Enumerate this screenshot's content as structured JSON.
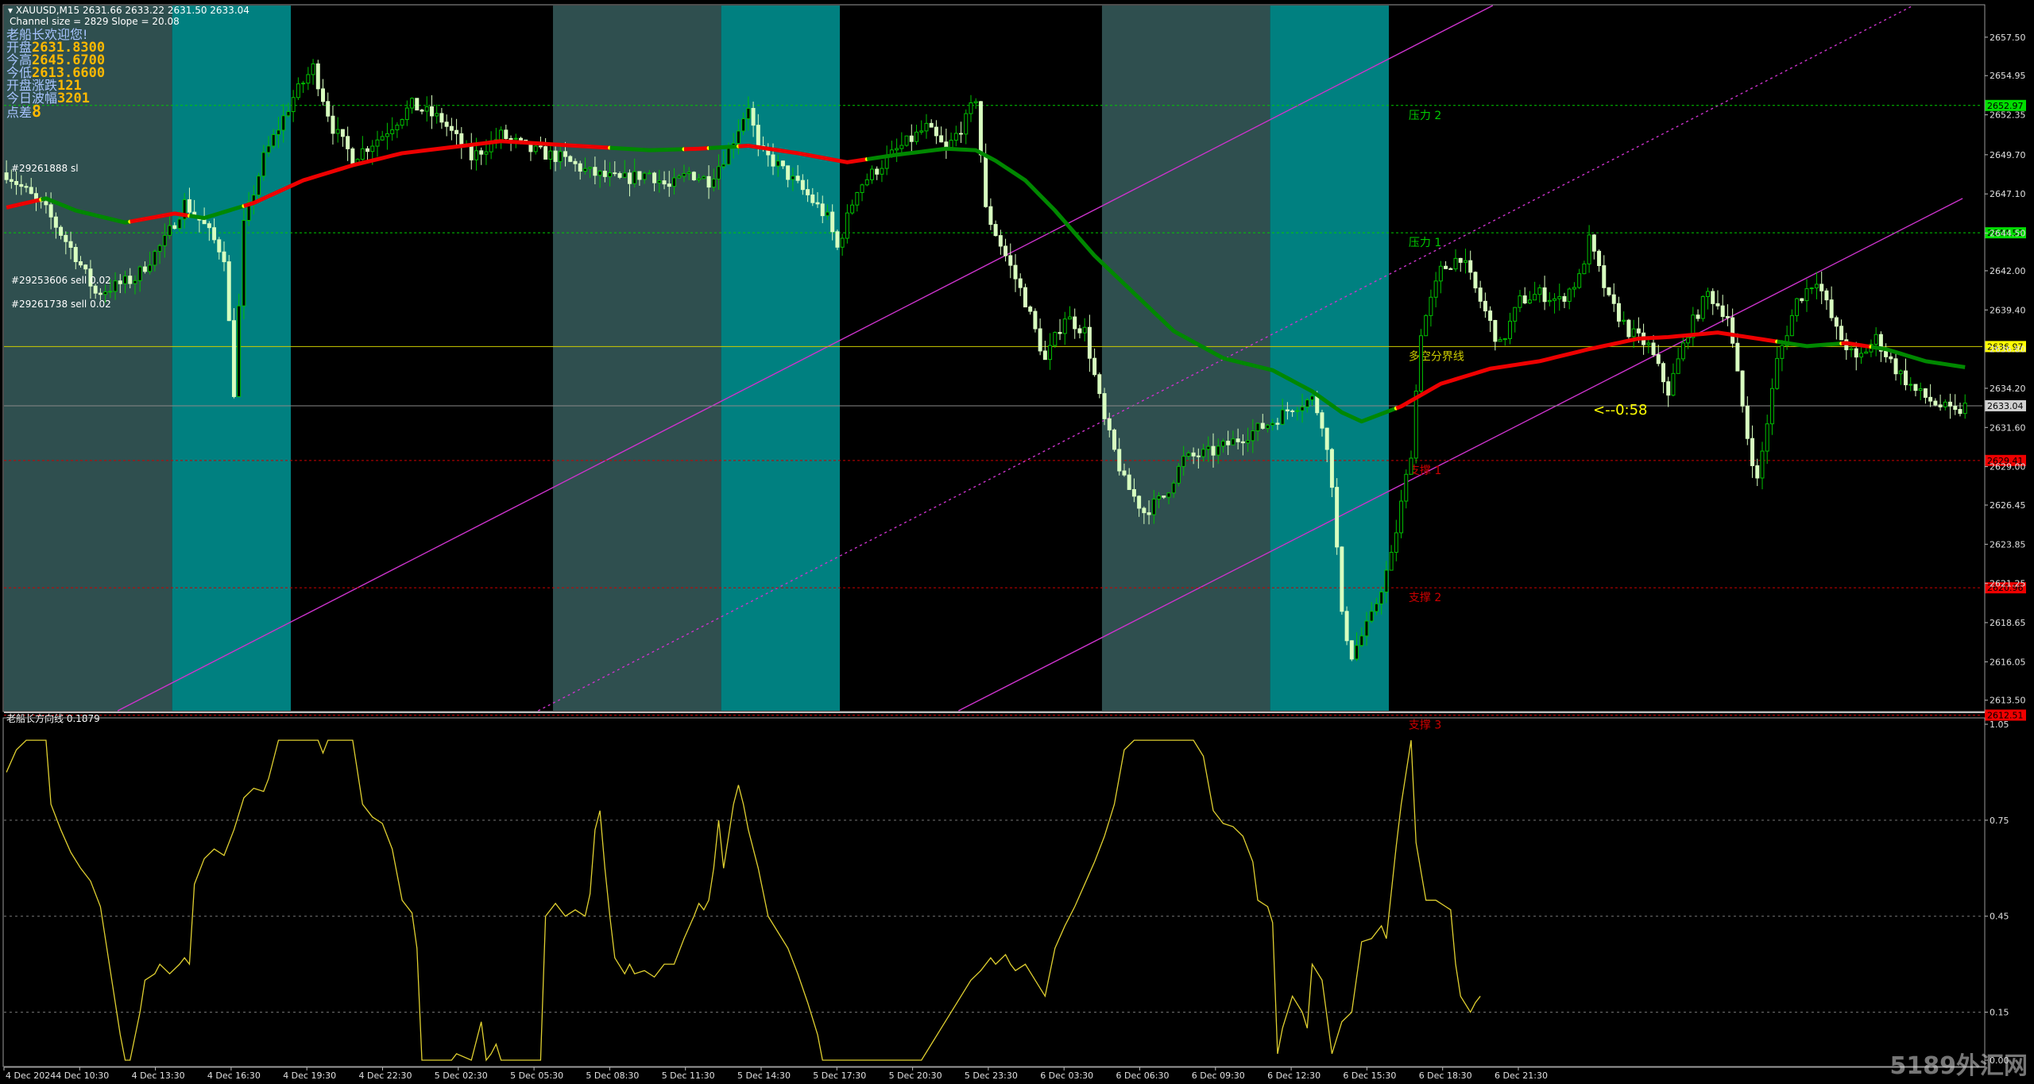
{
  "header": {
    "symbol_line": "XAUUSD,M15  2631.66 2633.22 2631.50 2633.04",
    "channel_line": "Channel size = 2829 Slope = 20.08"
  },
  "info_panel": {
    "welcome": "老船长欢迎您!",
    "rows": [
      {
        "label": "开盘",
        "value": "2631.8300"
      },
      {
        "label": "今高",
        "value": "2645.6700"
      },
      {
        "label": "今低",
        "value": "2613.6600"
      },
      {
        "label": "开盘涨跌",
        "value": "121"
      },
      {
        "label": "今日波幅",
        "value": "3201"
      },
      {
        "label": "点差",
        "value": "8"
      }
    ]
  },
  "order_labels": [
    "#29261888 sl",
    "#29253606 sell 0.02",
    "#29261738 sell 0.02"
  ],
  "countdown": "<--0:58",
  "colors": {
    "background": "#000000",
    "zone_gray": "#2f4f4f",
    "zone_teal": "#008080",
    "candle": "#d8ffc0",
    "candle_bull": "#00c000",
    "ma_up": "#ee0000",
    "ma_down": "#008800",
    "channel": "#cc33cc",
    "resistance": "#00cc00",
    "support": "#cc0000",
    "pivot": "#cccc00",
    "oscillator": "#e0d030"
  },
  "chart_data": [
    {
      "type": "candlestick",
      "title": "",
      "ylim": [
        2612.8,
        2659.6
      ],
      "y_ticks": [
        "2657.50",
        "2654.95",
        "2652.35",
        "2649.70",
        "2647.10",
        "2644.50",
        "2642.00",
        "2639.40",
        "2636.80",
        "2634.20",
        "2631.60",
        "2629.00",
        "2626.45",
        "2623.85",
        "2621.25",
        "2618.65",
        "2616.05",
        "2613.50"
      ],
      "x_labels": [
        "4 Dec 2024",
        "4 Dec 10:30",
        "4 Dec 13:30",
        "4 Dec 16:30",
        "4 Dec 19:30",
        "4 Dec 22:30",
        "5 Dec 02:30",
        "5 Dec 05:30",
        "5 Dec 08:30",
        "5 Dec 11:30",
        "5 Dec 14:30",
        "5 Dec 17:30",
        "5 Dec 20:30",
        "5 Dec 23:30",
        "6 Dec 03:30",
        "6 Dec 06:30",
        "6 Dec 09:30",
        "6 Dec 12:30",
        "6 Dec 15:30",
        "6 Dec 18:30",
        "6 Dec 21:30"
      ],
      "price_path": [
        [
          0,
          2648.5
        ],
        [
          8,
          2646
        ],
        [
          14,
          2643
        ],
        [
          18,
          2640.5
        ],
        [
          26,
          2641.5
        ],
        [
          32,
          2644
        ],
        [
          36,
          2646.5
        ],
        [
          40,
          2645
        ],
        [
          44,
          2643
        ],
        [
          46,
          2634
        ],
        [
          48,
          2645
        ],
        [
          52,
          2649.5
        ],
        [
          58,
          2653.5
        ],
        [
          62,
          2655.5
        ],
        [
          66,
          2651.5
        ],
        [
          70,
          2649.5
        ],
        [
          76,
          2651
        ],
        [
          82,
          2653
        ],
        [
          88,
          2652
        ],
        [
          94,
          2649.5
        ],
        [
          100,
          2651
        ],
        [
          106,
          2650
        ],
        [
          112,
          2649.5
        ],
        [
          118,
          2648.5
        ],
        [
          124,
          2648
        ],
        [
          130,
          2648.5
        ],
        [
          134,
          2647.5
        ],
        [
          138,
          2648.5
        ],
        [
          142,
          2648
        ],
        [
          146,
          2650
        ],
        [
          150,
          2653
        ],
        [
          152,
          2650
        ],
        [
          156,
          2649
        ],
        [
          162,
          2647
        ],
        [
          166,
          2645.5
        ],
        [
          168,
          2643.5
        ],
        [
          172,
          2647.5
        ],
        [
          180,
          2650
        ],
        [
          186,
          2651.5
        ],
        [
          190,
          2650
        ],
        [
          194,
          2652
        ],
        [
          196,
          2653.5
        ],
        [
          198,
          2646
        ],
        [
          202,
          2643
        ],
        [
          206,
          2640
        ],
        [
          210,
          2636
        ],
        [
          214,
          2639
        ],
        [
          218,
          2638
        ],
        [
          222,
          2632
        ],
        [
          226,
          2628
        ],
        [
          230,
          2626
        ],
        [
          234,
          2627
        ],
        [
          238,
          2629.5
        ],
        [
          244,
          2630
        ],
        [
          250,
          2631
        ],
        [
          256,
          2632
        ],
        [
          260,
          2633
        ],
        [
          264,
          2633.5
        ],
        [
          266,
          2632
        ],
        [
          268,
          2628
        ],
        [
          270,
          2619
        ],
        [
          272,
          2616.5
        ],
        [
          276,
          2619
        ],
        [
          280,
          2623
        ],
        [
          284,
          2630
        ],
        [
          286,
          2638
        ],
        [
          290,
          2642
        ],
        [
          294,
          2643
        ],
        [
          298,
          2640
        ],
        [
          302,
          2637
        ],
        [
          306,
          2640
        ],
        [
          310,
          2640.5
        ],
        [
          314,
          2640
        ],
        [
          318,
          2641.5
        ],
        [
          320,
          2644
        ],
        [
          324,
          2640
        ],
        [
          328,
          2638
        ],
        [
          332,
          2637
        ],
        [
          336,
          2634
        ],
        [
          340,
          2638
        ],
        [
          344,
          2640.5
        ],
        [
          348,
          2639
        ],
        [
          352,
          2631
        ],
        [
          354,
          2628
        ],
        [
          358,
          2636
        ],
        [
          362,
          2640
        ],
        [
          366,
          2641.5
        ],
        [
          370,
          2638
        ],
        [
          374,
          2636
        ],
        [
          378,
          2637.5
        ],
        [
          382,
          2635.5
        ],
        [
          386,
          2634
        ],
        [
          390,
          2633.2
        ],
        [
          394,
          2632.5
        ],
        [
          396,
          2633
        ]
      ],
      "moving_average_path": [
        [
          0,
          2646.2
        ],
        [
          8,
          2646.8
        ],
        [
          14,
          2646
        ],
        [
          24,
          2645.2
        ],
        [
          34,
          2645.8
        ],
        [
          40,
          2645.5
        ],
        [
          50,
          2646.5
        ],
        [
          60,
          2648
        ],
        [
          70,
          2649
        ],
        [
          80,
          2649.8
        ],
        [
          90,
          2650.2
        ],
        [
          100,
          2650.6
        ],
        [
          110,
          2650.4
        ],
        [
          120,
          2650.2
        ],
        [
          130,
          2650
        ],
        [
          140,
          2650.1
        ],
        [
          150,
          2650.3
        ],
        [
          160,
          2649.8
        ],
        [
          170,
          2649.2
        ],
        [
          180,
          2649.7
        ],
        [
          190,
          2650.1
        ],
        [
          196,
          2650
        ],
        [
          200,
          2649.3
        ],
        [
          206,
          2648
        ],
        [
          212,
          2646
        ],
        [
          220,
          2643
        ],
        [
          228,
          2640.5
        ],
        [
          236,
          2638
        ],
        [
          246,
          2636.2
        ],
        [
          256,
          2635.4
        ],
        [
          264,
          2634
        ],
        [
          270,
          2632.6
        ],
        [
          274,
          2632
        ],
        [
          282,
          2633
        ],
        [
          290,
          2634.5
        ],
        [
          300,
          2635.5
        ],
        [
          310,
          2636
        ],
        [
          320,
          2636.8
        ],
        [
          330,
          2637.5
        ],
        [
          336,
          2637.6
        ],
        [
          346,
          2637.9
        ],
        [
          354,
          2637.5
        ],
        [
          364,
          2637
        ],
        [
          372,
          2637.2
        ],
        [
          380,
          2636.8
        ],
        [
          388,
          2636
        ],
        [
          396,
          2635.6
        ]
      ],
      "ma_up_segments": [
        [
          0,
          7
        ],
        [
          25,
          37
        ],
        [
          48,
          122
        ],
        [
          137,
          142
        ],
        [
          148,
          174
        ],
        [
          281,
          358
        ],
        [
          371,
          377
        ]
      ],
      "levels": [
        {
          "label": "压力 2",
          "price": "2652.97",
          "kind": "resistance"
        },
        {
          "label": "压力 1",
          "price": "2644.52",
          "kind": "resistance"
        },
        {
          "label": "多空分界线",
          "price": "2636.97",
          "kind": "pivot"
        },
        {
          "label": "",
          "price": "2633.04",
          "kind": "current"
        },
        {
          "label": "支撑 1",
          "price": "2629.41",
          "kind": "support"
        },
        {
          "label": "支撑 2",
          "price": "2620.96",
          "kind": "support"
        },
        {
          "label": "支撑 3",
          "price": "2612.51",
          "kind": "support"
        }
      ],
      "zones": [
        {
          "from": 0,
          "to": 34,
          "kind": "gray"
        },
        {
          "from": 34,
          "to": 58,
          "kind": "teal"
        },
        {
          "from": 111,
          "to": 145,
          "kind": "gray"
        },
        {
          "from": 145,
          "to": 169,
          "kind": "teal"
        },
        {
          "from": 222,
          "to": 256,
          "kind": "gray"
        },
        {
          "from": 256,
          "to": 280,
          "kind": "teal"
        }
      ],
      "channel_lines": [
        {
          "kind": "solid",
          "points": [
            [
              23,
              2612.8
            ],
            [
              301,
              2659.6
            ]
          ]
        },
        {
          "kind": "dotted",
          "points": [
            [
              108,
              2612.8
            ],
            [
              386,
              2659.6
            ]
          ]
        },
        {
          "kind": "solid",
          "points": [
            [
              193,
              2612.8
            ],
            [
              396,
              2646.8
            ]
          ]
        }
      ]
    },
    {
      "type": "line",
      "title": "老船长方向线 0.1879",
      "ylim": [
        0,
        1.05
      ],
      "y_ticks": [
        "1.05",
        "0.75",
        "0.45",
        "0.15",
        "0.00"
      ],
      "values": [
        [
          0,
          0.9
        ],
        [
          2,
          0.97
        ],
        [
          4,
          1.0
        ],
        [
          8,
          1.0
        ],
        [
          9,
          0.8
        ],
        [
          11,
          0.72
        ],
        [
          13,
          0.65
        ],
        [
          15,
          0.6
        ],
        [
          17,
          0.56
        ],
        [
          19,
          0.48
        ],
        [
          21,
          0.28
        ],
        [
          23,
          0.08
        ],
        [
          24,
          0
        ],
        [
          25,
          0
        ],
        [
          27,
          0.15
        ],
        [
          28,
          0.25
        ],
        [
          30,
          0.27
        ],
        [
          31,
          0.3
        ],
        [
          33,
          0.27
        ],
        [
          35,
          0.3
        ],
        [
          36,
          0.32
        ],
        [
          37,
          0.3
        ],
        [
          38,
          0.55
        ],
        [
          40,
          0.63
        ],
        [
          42,
          0.66
        ],
        [
          44,
          0.64
        ],
        [
          46,
          0.72
        ],
        [
          48,
          0.82
        ],
        [
          50,
          0.85
        ],
        [
          52,
          0.84
        ],
        [
          53,
          0.88
        ],
        [
          55,
          1.0
        ],
        [
          63,
          1.0
        ],
        [
          64,
          0.96
        ],
        [
          65,
          1.0
        ],
        [
          70,
          1.0
        ],
        [
          72,
          0.8
        ],
        [
          74,
          0.76
        ],
        [
          76,
          0.74
        ],
        [
          78,
          0.66
        ],
        [
          80,
          0.5
        ],
        [
          82,
          0.46
        ],
        [
          83,
          0.35
        ],
        [
          84,
          0
        ],
        [
          90,
          0
        ],
        [
          91,
          0.02
        ],
        [
          94,
          0
        ],
        [
          96,
          0.12
        ],
        [
          97,
          0
        ],
        [
          98,
          0.02
        ],
        [
          99,
          0.05
        ],
        [
          100,
          0
        ],
        [
          108,
          0
        ],
        [
          109,
          0.45
        ],
        [
          111,
          0.49
        ],
        [
          113,
          0.45
        ],
        [
          115,
          0.47
        ],
        [
          117,
          0.45
        ],
        [
          118,
          0.52
        ],
        [
          119,
          0.72
        ],
        [
          120,
          0.78
        ],
        [
          121,
          0.6
        ],
        [
          122,
          0.45
        ],
        [
          123,
          0.32
        ],
        [
          125,
          0.27
        ],
        [
          126,
          0.3
        ],
        [
          127,
          0.27
        ],
        [
          129,
          0.28
        ],
        [
          131,
          0.26
        ],
        [
          133,
          0.3
        ],
        [
          135,
          0.3
        ],
        [
          137,
          0.38
        ],
        [
          139,
          0.45
        ],
        [
          140,
          0.49
        ],
        [
          141,
          0.47
        ],
        [
          142,
          0.5
        ],
        [
          143,
          0.6
        ],
        [
          144,
          0.75
        ],
        [
          145,
          0.6
        ],
        [
          147,
          0.8
        ],
        [
          148,
          0.86
        ],
        [
          149,
          0.8
        ],
        [
          150,
          0.72
        ],
        [
          152,
          0.6
        ],
        [
          154,
          0.45
        ],
        [
          156,
          0.4
        ],
        [
          158,
          0.35
        ],
        [
          160,
          0.27
        ],
        [
          162,
          0.18
        ],
        [
          164,
          0.08
        ],
        [
          165,
          0
        ],
        [
          185,
          0
        ],
        [
          187,
          0.05
        ],
        [
          189,
          0.1
        ],
        [
          191,
          0.15
        ],
        [
          193,
          0.2
        ],
        [
          195,
          0.25
        ],
        [
          197,
          0.28
        ],
        [
          199,
          0.32
        ],
        [
          200,
          0.3
        ],
        [
          202,
          0.33
        ],
        [
          203,
          0.3
        ],
        [
          204,
          0.28
        ],
        [
          206,
          0.3
        ],
        [
          208,
          0.25
        ],
        [
          210,
          0.2
        ],
        [
          212,
          0.35
        ],
        [
          214,
          0.42
        ],
        [
          216,
          0.48
        ],
        [
          218,
          0.55
        ],
        [
          220,
          0.62
        ],
        [
          222,
          0.7
        ],
        [
          224,
          0.8
        ],
        [
          226,
          0.97
        ],
        [
          228,
          1.0
        ],
        [
          240,
          1.0
        ],
        [
          242,
          0.95
        ],
        [
          244,
          0.78
        ],
        [
          246,
          0.74
        ],
        [
          248,
          0.73
        ],
        [
          250,
          0.7
        ],
        [
          252,
          0.62
        ],
        [
          253,
          0.5
        ],
        [
          255,
          0.48
        ],
        [
          256,
          0.43
        ],
        [
          257,
          0.02
        ],
        [
          258,
          0.1
        ],
        [
          260,
          0.2
        ],
        [
          262,
          0.15
        ],
        [
          263,
          0.1
        ],
        [
          264,
          0.3
        ],
        [
          266,
          0.25
        ],
        [
          268,
          0.02
        ],
        [
          270,
          0.12
        ],
        [
          272,
          0.15
        ],
        [
          274,
          0.37
        ],
        [
          276,
          0.38
        ],
        [
          278,
          0.42
        ],
        [
          279,
          0.38
        ],
        [
          281,
          0.67
        ],
        [
          282,
          0.8
        ],
        [
          283,
          0.9
        ],
        [
          284,
          1.0
        ],
        [
          285,
          0.68
        ],
        [
          287,
          0.5
        ],
        [
          289,
          0.5
        ],
        [
          291,
          0.48
        ],
        [
          292,
          0.47
        ],
        [
          293,
          0.3
        ],
        [
          294,
          0.2
        ],
        [
          296,
          0.15
        ],
        [
          297,
          0.18
        ],
        [
          298,
          0.2
        ]
      ]
    }
  ]
}
